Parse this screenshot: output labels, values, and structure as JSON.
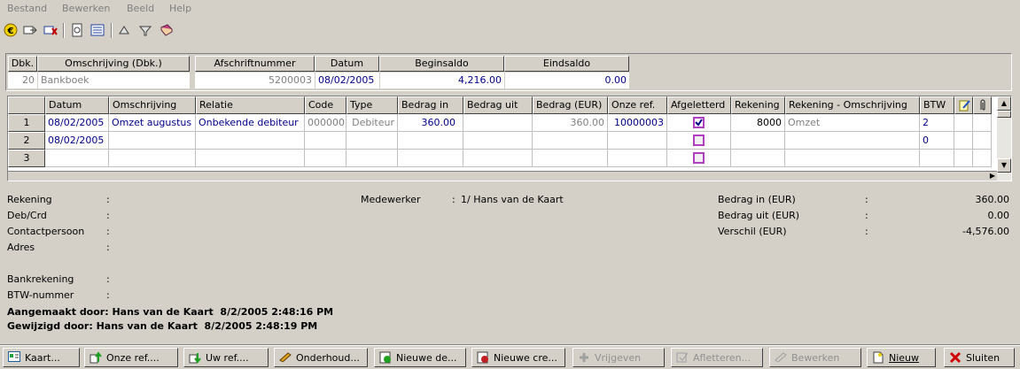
{
  "menu": [
    "Bestand",
    "Bewerken",
    "Beeld",
    "Help"
  ],
  "toolbar_icons": [
    "euro-icon",
    "import-icon",
    "delete-icon",
    "preview-icon",
    "list-icon",
    "arrow-up-icon",
    "filter-icon",
    "book-icon"
  ],
  "header": {
    "columns": [
      "Dbk.",
      "Omschrijving (Dbk.)",
      "Afschriftnummer",
      "Datum",
      "Beginsaldo",
      "Eindsaldo"
    ],
    "values": {
      "dbk": "20",
      "omschrijving": "Bankboek",
      "afschrift": "5200003",
      "datum": "08/02/2005",
      "beginsaldo": "4,216.00",
      "eindsaldo": "0.00"
    }
  },
  "grid": {
    "columns": [
      "Datum",
      "Omschrijving",
      "Relatie",
      "Code",
      "Type",
      "Bedrag in",
      "Bedrag uit",
      "Bedrag (EUR)",
      "Onze ref.",
      "Afgeletterd",
      "Rekening",
      "Rekening - Omschrijving",
      "BTW"
    ],
    "rows": [
      {
        "num": "1",
        "datum": "08/02/2005",
        "omschrijving": "Omzet augustus",
        "relatie": "Onbekende debiteur",
        "code": "000000",
        "type": "Debiteur",
        "bedrag_in": "360.00",
        "bedrag_uit": "",
        "bedrag_eur": "360.00",
        "onze_ref": "10000003",
        "afgeletterd": true,
        "rekening": "8000",
        "rek_omschr": "Omzet",
        "btw": "2"
      },
      {
        "num": "2",
        "datum": "08/02/2005",
        "omschrijving": "",
        "relatie": "",
        "code": "",
        "type": "",
        "bedrag_in": "",
        "bedrag_uit": "",
        "bedrag_eur": "",
        "onze_ref": "",
        "afgeletterd": false,
        "rekening": "",
        "rek_omschr": "",
        "btw": "0"
      },
      {
        "num": "3",
        "datum": "",
        "omschrijving": "",
        "relatie": "",
        "code": "",
        "type": "",
        "bedrag_in": "",
        "bedrag_uit": "",
        "bedrag_eur": "",
        "onze_ref": "",
        "afgeletterd": false,
        "rekening": "",
        "rek_omschr": "",
        "btw": ""
      }
    ]
  },
  "details": {
    "left_labels": [
      "Rekening",
      "Deb/Crd",
      "Contactpersoon",
      "Adres",
      "Bankrekening",
      "BTW-nummer"
    ],
    "colon": ":",
    "medewerker_label": "Medewerker",
    "medewerker_value": "1/ Hans van de Kaart",
    "bedrag_in_label": "Bedrag in (EUR)",
    "bedrag_in_value": "360.00",
    "bedrag_uit_label": "Bedrag uit (EUR)",
    "bedrag_uit_value": "0.00",
    "verschil_label": "Verschil (EUR)",
    "verschil_value": "-4,576.00",
    "aangemaakt": "Aangemaakt door: Hans van de Kaart  8/2/2005 2:48:16 PM",
    "gewijzigd": "Gewijzigd door: Hans van de Kaart  8/2/2005 2:48:19 PM"
  },
  "buttons": {
    "kaart": "Kaart...",
    "onze_ref": "Onze ref....",
    "uw_ref": "Uw ref....",
    "onderhoud": "Onderhoud...",
    "nieuwe_de": "Nieuwe de...",
    "nieuwe_cre": "Nieuwe cre...",
    "vrijgeven": "Vrijgeven",
    "afletteren": "Afletteren...",
    "bewerken": "Bewerken",
    "nieuw": "Nieuw",
    "sluiten": "Sluiten"
  }
}
